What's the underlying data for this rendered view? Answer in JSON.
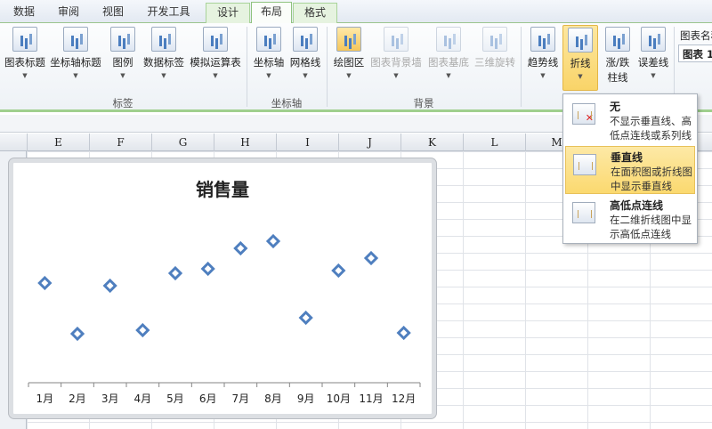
{
  "tabs": [
    "数据",
    "审阅",
    "视图",
    "开发工具",
    "设计",
    "布局",
    "格式"
  ],
  "ribbon": {
    "labels_group": {
      "name": "标签",
      "buttons": [
        "图表标题",
        "坐标轴标题",
        "图例",
        "数据标签",
        "模拟运算表"
      ]
    },
    "axes_group": {
      "name": "坐标轴",
      "buttons": [
        "坐标轴",
        "网格线"
      ]
    },
    "background_group": {
      "name": "背景",
      "buttons": [
        "绘图区",
        "图表背景墙",
        "图表基底",
        "三维旋转"
      ]
    },
    "analysis_group": {
      "buttons": [
        "趋势线",
        "折线",
        "涨/跌",
        "柱线",
        "误差线"
      ]
    },
    "properties": {
      "label": "图表名称",
      "value": "图表 1"
    }
  },
  "columns": [
    "E",
    "F",
    "G",
    "H",
    "I",
    "J",
    "K",
    "L",
    "M"
  ],
  "lines_menu": [
    {
      "title": "无",
      "desc": "不显示垂直线、高低点连线或系列线"
    },
    {
      "title": "垂直线",
      "desc": "在面积图或折线图中显示垂直线"
    },
    {
      "title": "高低点连线",
      "desc": "在二维折线图中显示高低点连线"
    }
  ],
  "chart_data": {
    "type": "scatter",
    "title": "销售量",
    "categories": [
      "1月",
      "2月",
      "3月",
      "4月",
      "5月",
      "6月",
      "7月",
      "8月",
      "9月",
      "10月",
      "11月",
      "12月"
    ],
    "values": [
      112,
      55,
      109,
      59,
      123,
      128,
      151,
      159,
      73,
      126,
      140,
      56
    ],
    "ylim": [
      0,
      220
    ],
    "marker": "diamond",
    "color": "#4f7fbf",
    "grid": false,
    "legend": "none"
  }
}
